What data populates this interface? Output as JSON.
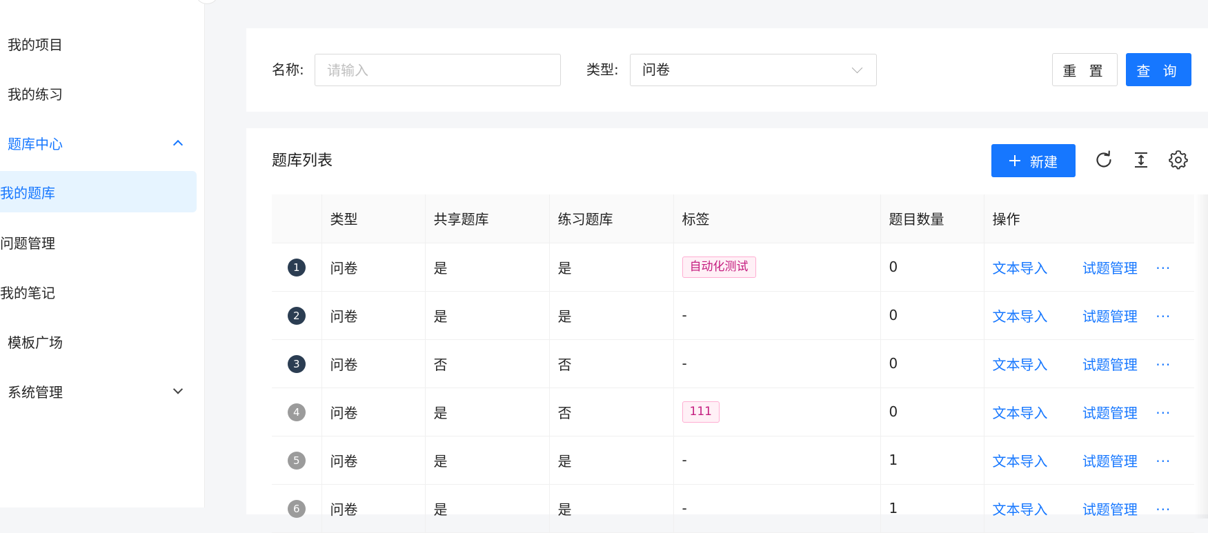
{
  "sidebar": {
    "items": [
      {
        "label": "我的项目"
      },
      {
        "label": "我的练习"
      },
      {
        "label": "题库中心"
      },
      {
        "label": "我的题库"
      },
      {
        "label": "问题管理"
      },
      {
        "label": "我的笔记"
      },
      {
        "label": "模板广场"
      },
      {
        "label": "系统管理"
      }
    ]
  },
  "search": {
    "name_label": "名称:",
    "name_placeholder": "请输入",
    "name_value": "",
    "type_label": "类型:",
    "type_value": "问卷",
    "reset_label": "重 置",
    "query_label": "查 询"
  },
  "list": {
    "title": "题库列表",
    "new_label": "新建",
    "columns": [
      "",
      "类型",
      "共享题库",
      "练习题库",
      "标签",
      "题目数量",
      "操作"
    ],
    "rows": [
      {
        "index": "1",
        "type": "问卷",
        "shared": "是",
        "practice": "是",
        "tag": "自动化测试",
        "count": "0",
        "import": "文本导入",
        "manage": "试题管理",
        "more": "···"
      },
      {
        "index": "2",
        "type": "问卷",
        "shared": "是",
        "practice": "是",
        "tag": "-",
        "count": "0",
        "import": "文本导入",
        "manage": "试题管理",
        "more": "···"
      },
      {
        "index": "3",
        "type": "问卷",
        "shared": "否",
        "practice": "否",
        "tag": "-",
        "count": "0",
        "import": "文本导入",
        "manage": "试题管理",
        "more": "···"
      },
      {
        "index": "4",
        "type": "问卷",
        "shared": "是",
        "practice": "否",
        "tag": "111",
        "count": "0",
        "import": "文本导入",
        "manage": "试题管理",
        "more": "···"
      },
      {
        "index": "5",
        "type": "问卷",
        "shared": "是",
        "practice": "是",
        "tag": "-",
        "count": "1",
        "import": "文本导入",
        "manage": "试题管理",
        "more": "···"
      },
      {
        "index": "6",
        "type": "问卷",
        "shared": "是",
        "practice": "是",
        "tag": "-",
        "count": "1",
        "import": "文本导入",
        "manage": "试题管理",
        "more": "···"
      }
    ]
  },
  "colors": {
    "primary": "#1677ff",
    "index_dark": "#2b3d52",
    "index_gray": "#9b9b9b",
    "tag_text": "#c41d7f"
  },
  "icons": {
    "refresh": "refresh-icon",
    "density": "column-height-icon",
    "settings": "setting-icon"
  }
}
